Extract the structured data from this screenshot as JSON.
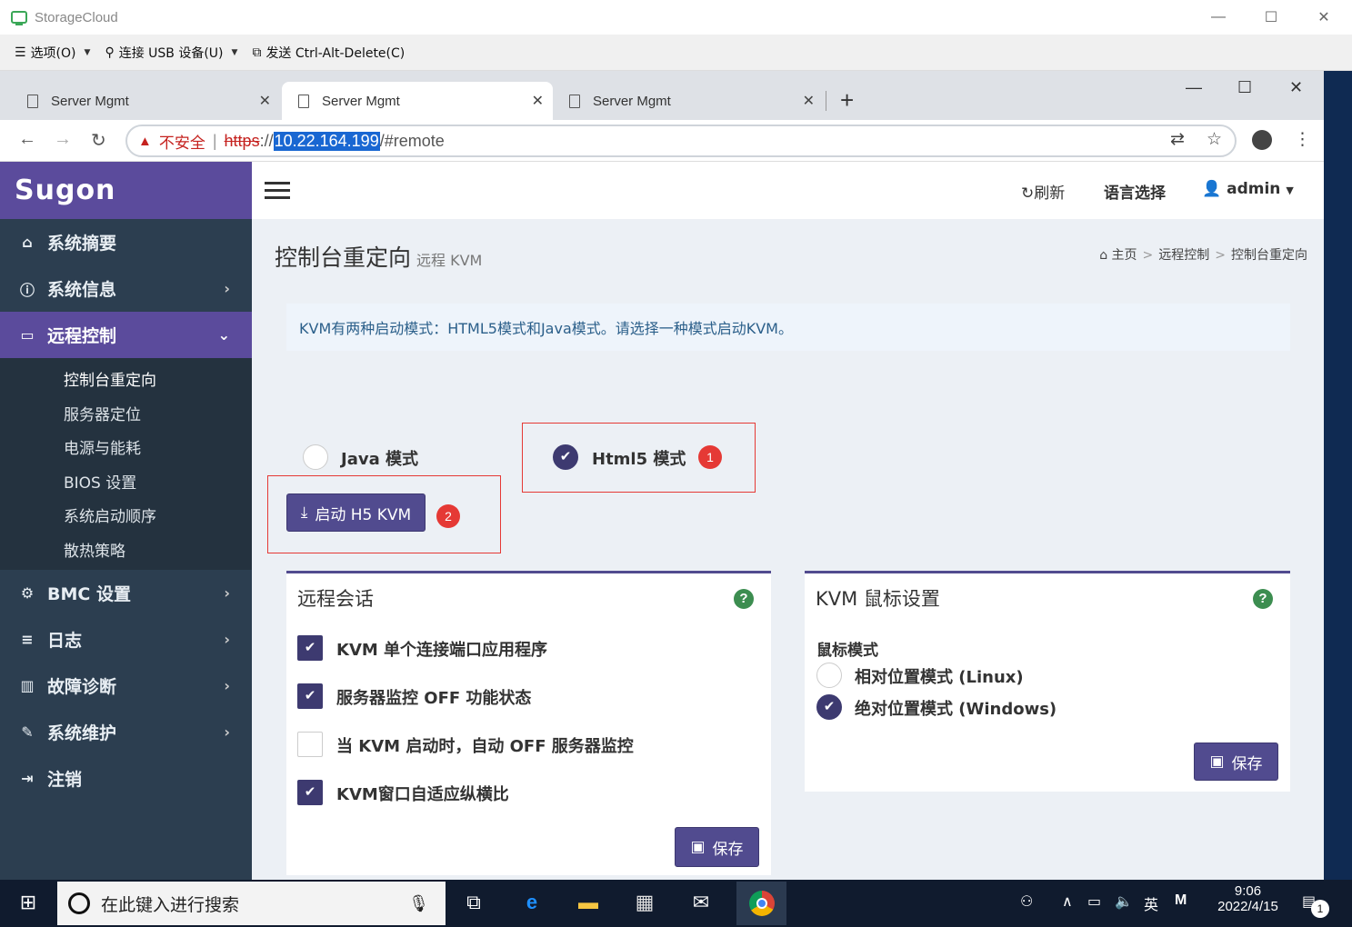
{
  "outer_window": {
    "title": "StorageCloud",
    "minimize": "—",
    "maximize": "☐",
    "close": "✕"
  },
  "outer_menu": [
    {
      "label": "选项(O)"
    },
    {
      "label": "连接 USB 设备(U)"
    },
    {
      "label": "发送 Ctrl-Alt-Delete(C)"
    }
  ],
  "browser": {
    "tabs": [
      {
        "title": "Server Mgmt"
      },
      {
        "title": "Server Mgmt"
      },
      {
        "title": "Server Mgmt"
      }
    ],
    "new_tab": "+",
    "url": {
      "insecure": "不安全",
      "scheme": "https",
      "sep": "://",
      "host": "10.22.164.199",
      "path": "/#remote"
    }
  },
  "sidebar": {
    "brand": "Sugon",
    "items": [
      {
        "label": "系统摘要",
        "icon": "home-icon"
      },
      {
        "label": "系统信息",
        "icon": "info-icon"
      },
      {
        "label": "远程控制",
        "icon": "monitor-icon"
      },
      {
        "label": "BMC 设置",
        "icon": "gear-icon"
      },
      {
        "label": "日志",
        "icon": "database-icon"
      },
      {
        "label": "故障诊断",
        "icon": "bar-chart-icon"
      },
      {
        "label": "系统维护",
        "icon": "wrench-icon"
      },
      {
        "label": "注销",
        "icon": "logout-icon"
      }
    ],
    "submenu": [
      "控制台重定向",
      "服务器定位",
      "电源与能耗",
      "BIOS 设置",
      "系统启动顺序",
      "散热策略"
    ]
  },
  "topbar": {
    "refresh": "刷新",
    "language": "语言选择",
    "user": "admin"
  },
  "header": {
    "title": "控制台重定向",
    "subtitle": "远程 KVM"
  },
  "breadcrumb": [
    "主页",
    "远程控制",
    "控制台重定向"
  ],
  "info_text": "KVM有两种启动模式：HTML5模式和Java模式。请选择一种模式启动KVM。",
  "mode": {
    "java_label": "Java 模式",
    "html5_label": "Html5 模式",
    "selected": "html5"
  },
  "launch_button": "启动 H5 KVM",
  "badges": {
    "one": "1",
    "two": "2"
  },
  "remote_session": {
    "title": "远程会话",
    "options": [
      {
        "label": "KVM 单个连接端口应用程序",
        "checked": true
      },
      {
        "label": "服务器监控 OFF 功能状态",
        "checked": true
      },
      {
        "label": "当 KVM 启动时，自动 OFF 服务器监控",
        "checked": false
      },
      {
        "label": "KVM窗口自适应纵横比",
        "checked": true
      }
    ],
    "save": "保存"
  },
  "mouse_settings": {
    "title": "KVM 鼠标设置",
    "mode_label": "鼠标模式",
    "options": [
      {
        "label": "相对位置模式 (Linux)",
        "checked": false
      },
      {
        "label": "绝对位置模式 (Windows)",
        "checked": true
      }
    ],
    "save": "保存"
  },
  "taskbar": {
    "search_placeholder": "在此键入进行搜索",
    "ime": "英",
    "time": "9:06",
    "date": "2022/4/15",
    "notif_count": "1"
  },
  "colors": {
    "brand": "#5b4b9c",
    "sidebar": "#2c3e50",
    "accent": "#514b8f",
    "badge": "#e53935"
  }
}
